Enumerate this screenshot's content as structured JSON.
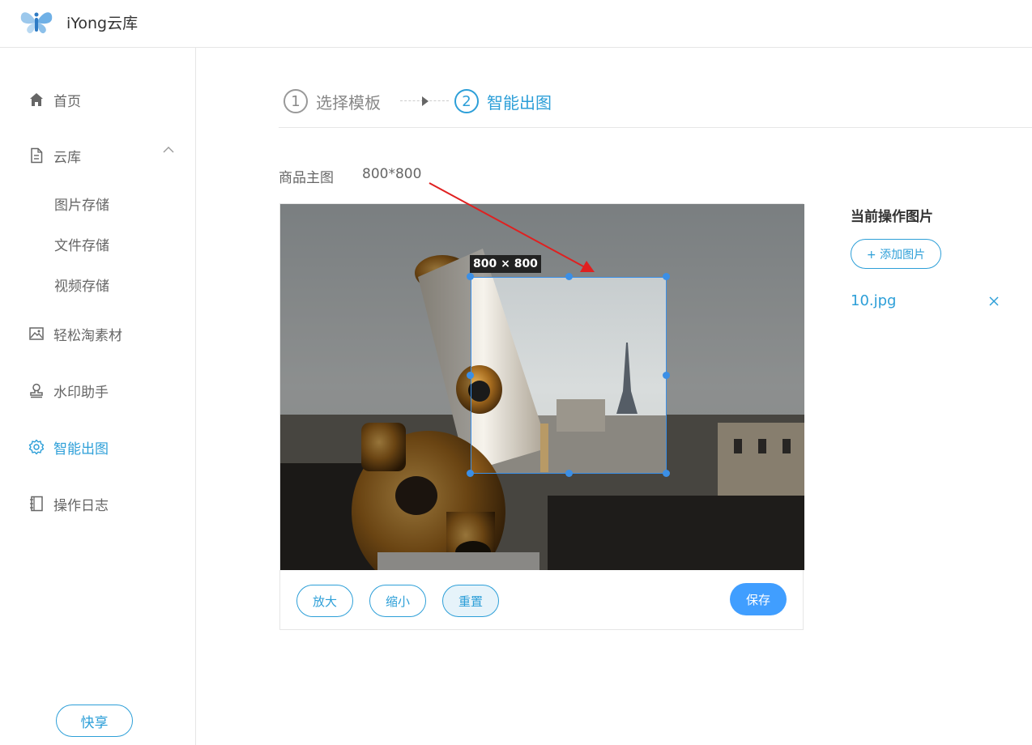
{
  "header": {
    "app_title": "iYong云库",
    "logo_icon": "butterfly-logo"
  },
  "sidebar": {
    "items": [
      {
        "label": "首页",
        "icon": "home-icon"
      },
      {
        "label": "云库",
        "icon": "document-icon",
        "expanded": true,
        "children": [
          "图片存储",
          "文件存储",
          "视频存储"
        ]
      },
      {
        "label": "轻松淘素材",
        "icon": "image-icon"
      },
      {
        "label": "水印助手",
        "icon": "stamp-icon"
      },
      {
        "label": "智能出图",
        "icon": "gear-icon",
        "active": true
      },
      {
        "label": "操作日志",
        "icon": "notebook-icon"
      }
    ],
    "share_label": "快享"
  },
  "steps": [
    {
      "num": "1",
      "label": "选择模板"
    },
    {
      "num": "2",
      "label": "智能出图"
    }
  ],
  "editor": {
    "product_label": "商品主图",
    "product_size": "800*800",
    "crop_label": "800 × 800",
    "zoom_in": "放大",
    "zoom_out": "缩小",
    "reset": "重置",
    "save": "保存"
  },
  "panel": {
    "title": "当前操作图片",
    "add_button": "+ 添加图片",
    "file_name": "10.jpg"
  },
  "colors": {
    "accent": "#2d9fd8",
    "save": "#409eff",
    "crop": "#3b8fe6",
    "annotation": "#e02020"
  }
}
